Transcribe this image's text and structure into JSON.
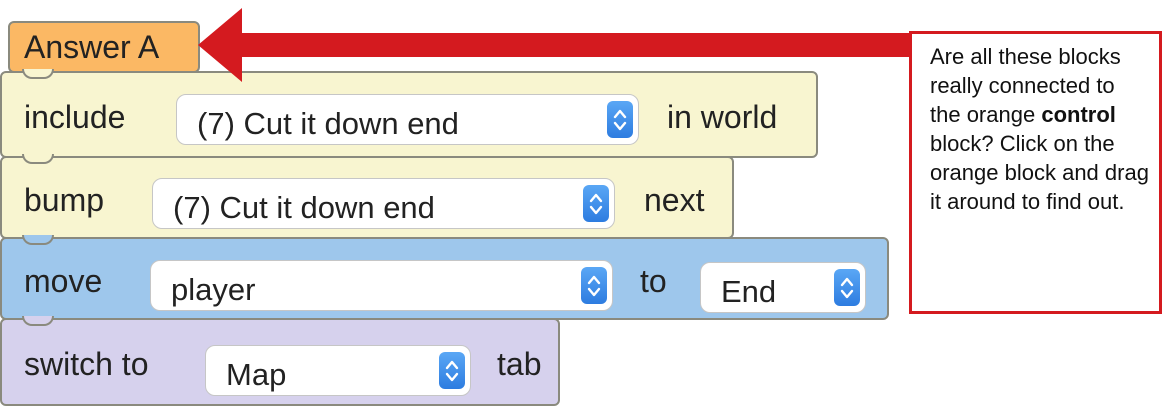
{
  "blocks": {
    "control": {
      "label": "Answer A",
      "color": "#fbb864"
    },
    "include": {
      "prefix": "include",
      "selected": "(7) Cut it down end",
      "suffix": "in world",
      "color": "#f8f5d0"
    },
    "bump": {
      "prefix": "bump",
      "selected": "(7) Cut it down end",
      "suffix": "next",
      "color": "#f8f5d0"
    },
    "move": {
      "prefix": "move",
      "target": "player",
      "middle": "to",
      "destination": "End",
      "color": "#9ec7ec"
    },
    "switch": {
      "prefix": "switch to",
      "selected": "Map",
      "suffix": "tab",
      "color": "#d6d1ed"
    }
  },
  "annotation": {
    "arrow_color": "#d41a1f",
    "text_before": "Are all these blocks really connected to the orange",
    "text_bold": "control",
    "text_after": "block? Click on the orange block and drag it around to find out."
  },
  "icons": {
    "stepper": "up-down-chevron-icon"
  }
}
